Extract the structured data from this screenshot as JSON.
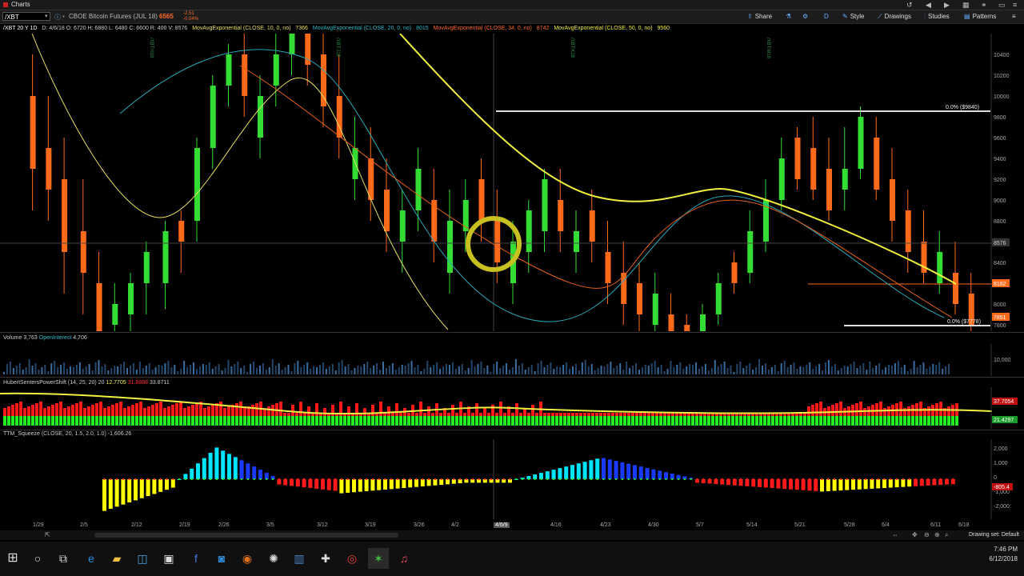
{
  "titlebar": {
    "tab_label": "Charts"
  },
  "toolbar": {
    "symbol": "/XBT",
    "instrument": "CBOE Bitcoin Futures (JUL 18)",
    "last": "6565",
    "change_top": "-2.51",
    "change_bottom": "-0.04%",
    "share": "Share",
    "timeframe": "D",
    "style": "Style",
    "drawings": "Drawings",
    "studies": "Studies",
    "patterns": "Patterns"
  },
  "study_header": {
    "label": "/XBT 20 Y 1D",
    "ohlc": "D: 4/6/18   O: 6720   H: 6880   L: 6480   C: 6600   R: 400   V: 8576",
    "ma10": "MovAvgExponential (CLOSE, 10, 0, no)",
    "ma10_val": "7366",
    "ma20": "MovAvgExponential (CLOSE, 20, 0, no)",
    "ma20_val": "8015",
    "ma34": "MovAvgExponential (CLOSE, 34, 0, no)",
    "ma34_val": "8742",
    "ma50": "MovAvgExponential (CLOSE, 50, 0, no)",
    "ma50_val": "9560"
  },
  "price_axis": {
    "ticks": [
      "10400",
      "10200",
      "10000",
      "9800",
      "9600",
      "9400",
      "9200",
      "9000",
      "8800",
      "8600",
      "8400",
      "8200",
      "8000",
      "7800"
    ],
    "cursor_label": "8576",
    "ma_label": "8182",
    "low_label": "7851"
  },
  "annotations": {
    "fib_high": "0.0% ($9840)",
    "fib_low": "0.0% ($7778)",
    "roll_label_1": "/XBT:H18",
    "roll_label_2": "/XBT:J18",
    "roll_label_3": "/XBT:K18",
    "roll_label_4": "/XBT:M18"
  },
  "volume_pane": {
    "label": "Volume",
    "value": "3,763",
    "oi_label": "OpenInterest",
    "oi_value": "4,706",
    "axis": "10,000"
  },
  "power_pane": {
    "label": "HubertSentersPowerShift (14, 25, 20)",
    "v1": "20",
    "v2": "12.7705",
    "v3": "31.8888",
    "v4": "33.8711",
    "axis_top": "37.7054",
    "axis_bottom": "21.4297"
  },
  "squeeze_pane": {
    "label": "TTM_Squeeze (CLOSE, 20, 1.5, 2.0, 1.0)",
    "value": "-1,606.26",
    "axis": [
      "2,000",
      "1,000",
      "0",
      "-1,000",
      "-2,000"
    ],
    "current": "-805.4"
  },
  "xaxis": {
    "labels": [
      "1/29",
      "2/5",
      "2/12",
      "2/19",
      "2/26",
      "3/5",
      "3/12",
      "3/19",
      "3/26",
      "4/2",
      "4/6/9",
      "4/16",
      "4/23",
      "4/30",
      "5/7",
      "5/14",
      "5/21",
      "5/28",
      "6/4",
      "6/11",
      "6/18"
    ]
  },
  "status": {
    "drawing_set": "Drawing set: Default"
  },
  "clock": {
    "time": "7:46 PM",
    "date": "6/12/2018"
  },
  "colors": {
    "up": "#33dd33",
    "down": "#ff6a1a",
    "ma10": "#e8e060",
    "ma20": "#2aa8b8",
    "ma34": "#e0601a",
    "ma50": "#f0f040"
  },
  "chart_data": {
    "type": "candlestick",
    "candles": [
      [
        8,
        1,
        10400,
        10000,
        9300,
        8900,
        "d"
      ],
      [
        13,
        1,
        10000,
        9500,
        9100,
        8800,
        "d"
      ],
      [
        18,
        1,
        9600,
        9200,
        8500,
        8100,
        "d"
      ],
      [
        24,
        1,
        9200,
        8700,
        8300,
        7900,
        "d"
      ],
      [
        29,
        1,
        8500,
        8200,
        7700,
        7400,
        "d"
      ],
      [
        34,
        1,
        8200,
        8000,
        7800,
        7500,
        "u"
      ],
      [
        39,
        1,
        8300,
        8200,
        7900,
        7600,
        "u"
      ],
      [
        44,
        1,
        8600,
        8500,
        8200,
        7900,
        "u"
      ],
      [
        50,
        1,
        8800,
        8700,
        8200,
        7950,
        "u"
      ],
      [
        55,
        1,
        8900,
        8800,
        8600,
        8300,
        "d"
      ],
      [
        60,
        1,
        9600,
        9500,
        8800,
        8600,
        "u"
      ],
      [
        65,
        1,
        10200,
        10100,
        9500,
        9300,
        "u"
      ],
      [
        70,
        1,
        10500,
        10400,
        10100,
        9900,
        "u"
      ],
      [
        75,
        1,
        10700,
        10400,
        10000,
        9800,
        "d"
      ],
      [
        80,
        1,
        10200,
        10000,
        9600,
        9400,
        "u"
      ],
      [
        85,
        1,
        10600,
        10400,
        10100,
        9900,
        "u"
      ],
      [
        90,
        1,
        10800,
        10700,
        10400,
        10200,
        "u"
      ],
      [
        95,
        1,
        10900,
        10700,
        10300,
        10100,
        "d"
      ],
      [
        100,
        1,
        10600,
        10400,
        9900,
        9700,
        "d"
      ],
      [
        105,
        1,
        10400,
        10000,
        9600,
        9400,
        "d"
      ],
      [
        110,
        1,
        9800,
        9500,
        9200,
        9000,
        "u"
      ],
      [
        115,
        1,
        9700,
        9400,
        9000,
        8800,
        "d"
      ],
      [
        120,
        1,
        9400,
        9100,
        8700,
        8500,
        "d"
      ],
      [
        125,
        1,
        9100,
        8900,
        8600,
        8300,
        "u"
      ],
      [
        130,
        1,
        9500,
        9300,
        8900,
        8700,
        "u"
      ],
      [
        135,
        1,
        9300,
        9000,
        8600,
        8400,
        "d"
      ],
      [
        140,
        1,
        9100,
        8800,
        8300,
        8100,
        "u"
      ],
      [
        145,
        1,
        9200,
        9000,
        8700,
        8500,
        "u"
      ],
      [
        150,
        1,
        9400,
        9200,
        8800,
        8600,
        "d"
      ],
      [
        155,
        1,
        9100,
        8800,
        8400,
        8200,
        "d"
      ],
      [
        160,
        1,
        8800,
        8600,
        8200,
        8000,
        "u"
      ],
      [
        165,
        1,
        9000,
        8900,
        8500,
        8300,
        "u"
      ],
      [
        170,
        1,
        9300,
        9200,
        8700,
        8500,
        "u"
      ],
      [
        175,
        1,
        9300,
        9000,
        8700,
        8500,
        "d"
      ],
      [
        180,
        1,
        8900,
        8700,
        8500,
        8300,
        "u"
      ],
      [
        185,
        1,
        9100,
        8900,
        8600,
        8400,
        "d"
      ],
      [
        190,
        1,
        8800,
        8500,
        8200,
        8000,
        "d"
      ],
      [
        195,
        1,
        8600,
        8300,
        8000,
        7800,
        "d"
      ],
      [
        200,
        1,
        8400,
        8200,
        7900,
        7700,
        "d"
      ],
      [
        205,
        1,
        8300,
        8100,
        7800,
        7600,
        "u"
      ],
      [
        210,
        1,
        8100,
        7900,
        7700,
        7500,
        "d"
      ],
      [
        215,
        1,
        7900,
        7800,
        7600,
        7500,
        "d"
      ],
      [
        220,
        1,
        8000,
        7900,
        7700,
        7600,
        "u"
      ],
      [
        225,
        1,
        8300,
        8200,
        7900,
        7800,
        "u"
      ],
      [
        230,
        1,
        8500,
        8400,
        8200,
        8100,
        "d"
      ],
      [
        235,
        1,
        8900,
        8700,
        8300,
        8200,
        "u"
      ],
      [
        240,
        1,
        9200,
        9000,
        8600,
        8500,
        "u"
      ],
      [
        245,
        1,
        9600,
        9400,
        9000,
        8900,
        "u"
      ],
      [
        250,
        1,
        9700,
        9600,
        9200,
        9100,
        "d"
      ],
      [
        255,
        1,
        9800,
        9500,
        9100,
        9000,
        "d"
      ],
      [
        260,
        1,
        9600,
        9300,
        8900,
        8800,
        "d"
      ],
      [
        265,
        1,
        9700,
        9300,
        9100,
        8900,
        "u"
      ],
      [
        270,
        1,
        9900,
        9800,
        9300,
        9200,
        "u"
      ],
      [
        275,
        1,
        9800,
        9600,
        9100,
        9000,
        "d"
      ],
      [
        280,
        1,
        9500,
        9200,
        8800,
        8600,
        "d"
      ],
      [
        285,
        1,
        9100,
        8900,
        8500,
        8300,
        "d"
      ],
      [
        290,
        1,
        8900,
        8600,
        8300,
        8200,
        "d"
      ],
      [
        295,
        1,
        8700,
        8500,
        8200,
        8100,
        "u"
      ],
      [
        300,
        1,
        8600,
        8300,
        8000,
        7900,
        "d"
      ],
      [
        305,
        1,
        8300,
        8100,
        7800,
        7700,
        "d"
      ]
    ]
  }
}
